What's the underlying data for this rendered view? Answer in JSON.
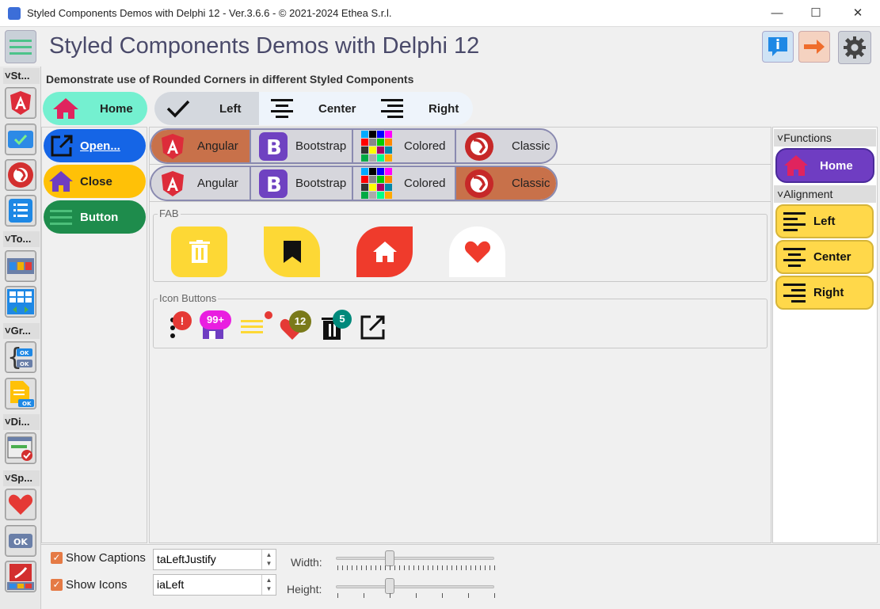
{
  "window": {
    "title": "Styled Components Demos with Delphi 12 - Ver.3.6.6 - © 2021-2024 Ethea S.r.l.",
    "minimize": "—",
    "maximize": "☐",
    "close": "✕"
  },
  "header": {
    "title": "Styled Components Demos with Delphi 12"
  },
  "sidebar": {
    "groups": [
      "St...",
      "To...",
      "Gr...",
      "Di...",
      "Sp..."
    ]
  },
  "description": "Demonstrate use of Rounded Corners in different Styled Components",
  "top_buttons": {
    "home": "Home",
    "left": "Left",
    "center": "Center",
    "right": "Right"
  },
  "left_buttons": {
    "open": "Open...",
    "close": "Close",
    "button": "Button"
  },
  "row1": [
    "Angular",
    "Bootstrap",
    "Colored",
    "Classic"
  ],
  "row2": [
    "Angular",
    "Bootstrap",
    "Colored",
    "Classic"
  ],
  "fab": {
    "label": "FAB"
  },
  "icon_buttons": {
    "label": "Icon Buttons",
    "badges": [
      "!",
      "99+",
      "12",
      "5"
    ]
  },
  "right_panel": {
    "functions_label": "Functions",
    "home": "Home",
    "alignment_label": "Alignment",
    "left": "Left",
    "center": "Center",
    "right": "Right"
  },
  "bottom": {
    "show_captions": "Show Captions",
    "show_icons": "Show Icons",
    "caption_align": "taLeftJustify",
    "icon_align": "iaLeft",
    "width_label": "Width:",
    "height_label": "Height:",
    "width_slider": 0.33,
    "height_slider": 0.33
  },
  "colors": {
    "accent": "#e57a45",
    "home_pill": "#74f0d0",
    "open": "#1565e6",
    "close": "#ffc107",
    "button": "#1e8c4c",
    "purple": "#6f3dc2",
    "yellow": "#ffd84a"
  }
}
